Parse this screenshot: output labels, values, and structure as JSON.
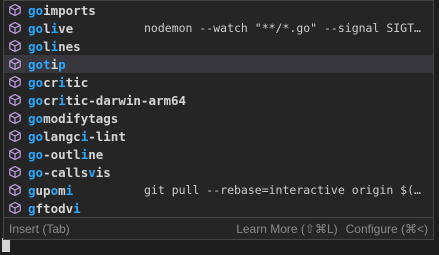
{
  "suggestions": [
    {
      "prefix": "go",
      "rest": "imports",
      "parts": [
        [
          "go",
          true
        ],
        [
          "imports",
          false
        ]
      ],
      "detail": ""
    },
    {
      "parts": [
        [
          "go",
          true
        ],
        [
          "l",
          false
        ],
        [
          "i",
          true
        ],
        [
          "ve",
          false
        ]
      ],
      "detail": "nodemon --watch \"**/*.go\" --signal SIGTERM --…"
    },
    {
      "parts": [
        [
          "go",
          true
        ],
        [
          "l",
          false
        ],
        [
          "i",
          true
        ],
        [
          "nes",
          false
        ]
      ],
      "detail": ""
    },
    {
      "parts": [
        [
          "got",
          true
        ],
        [
          "i",
          false
        ],
        [
          "p",
          true
        ]
      ],
      "detail": ""
    },
    {
      "parts": [
        [
          "go",
          true
        ],
        [
          "cr",
          false
        ],
        [
          "i",
          true
        ],
        [
          "tic",
          false
        ]
      ],
      "detail": ""
    },
    {
      "parts": [
        [
          "go",
          true
        ],
        [
          "cr",
          false
        ],
        [
          "i",
          true
        ],
        [
          "tic-darwin-arm64",
          false
        ]
      ],
      "detail": ""
    },
    {
      "parts": [
        [
          "go",
          true
        ],
        [
          "modifytags",
          false
        ]
      ],
      "detail": ""
    },
    {
      "parts": [
        [
          "go",
          true
        ],
        [
          "langc",
          false
        ],
        [
          "i",
          true
        ],
        [
          "-lint",
          false
        ]
      ],
      "detail": ""
    },
    {
      "parts": [
        [
          "go",
          true
        ],
        [
          "-outl",
          false
        ],
        [
          "i",
          true
        ],
        [
          "ne",
          false
        ]
      ],
      "detail": ""
    },
    {
      "parts": [
        [
          "go",
          true
        ],
        [
          "-calls",
          false
        ],
        [
          "v",
          true
        ],
        [
          "is",
          false
        ]
      ],
      "detail": ""
    },
    {
      "parts": [
        [
          "g",
          true
        ],
        [
          "up",
          false
        ],
        [
          "o",
          true
        ],
        [
          "m",
          false
        ],
        [
          "i",
          true
        ]
      ],
      "detail": "git pull --rebase=interactive origin $(git_m…"
    },
    {
      "parts": [
        [
          "g",
          true
        ],
        [
          "ftodv",
          false
        ],
        [
          "i",
          true
        ]
      ],
      "detail": ""
    }
  ],
  "selected_index": 3,
  "status": {
    "left": "Insert (Tab)",
    "learn_more": "Learn More (⇧⌘L)",
    "configure": "Configure (⌘<)"
  },
  "colors": {
    "match": "#2aaaff",
    "icon": "#c09ee0",
    "selected_bg": "#37373d"
  }
}
